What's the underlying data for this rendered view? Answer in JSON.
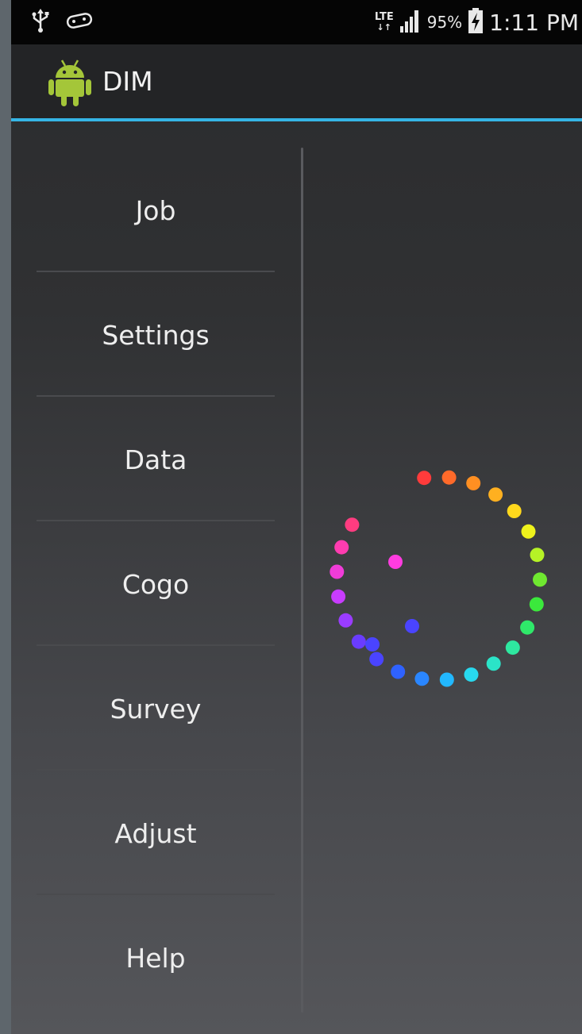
{
  "status_bar": {
    "left_icons": [
      "usb-icon",
      "controller-icon"
    ],
    "network": "LTE",
    "battery": "95%",
    "time": "1:11 PM"
  },
  "action_bar": {
    "app_icon": "android-icon",
    "title": "DIM"
  },
  "menu": {
    "items": [
      {
        "label": "Job"
      },
      {
        "label": "Settings"
      },
      {
        "label": "Data"
      },
      {
        "label": "Cogo"
      },
      {
        "label": "Survey"
      },
      {
        "label": "Adjust"
      },
      {
        "label": "Help"
      }
    ]
  },
  "loading_indicator": {
    "icon": "rainbow-dot-spinner-icon",
    "colors": [
      "#ff3b3b",
      "#ff6a2a",
      "#ff8f22",
      "#ffb020",
      "#ffd81c",
      "#eef21c",
      "#b6f226",
      "#6fe830",
      "#3be83c",
      "#2fe86a",
      "#2ee8a0",
      "#2be4c8",
      "#28d8ee",
      "#22b8ff",
      "#2a86ff",
      "#2f62ff",
      "#4a44ff",
      "#6a3cff",
      "#9a3cff",
      "#c83cff",
      "#f03cd8",
      "#ff3cb0",
      "#ff3c80"
    ]
  }
}
